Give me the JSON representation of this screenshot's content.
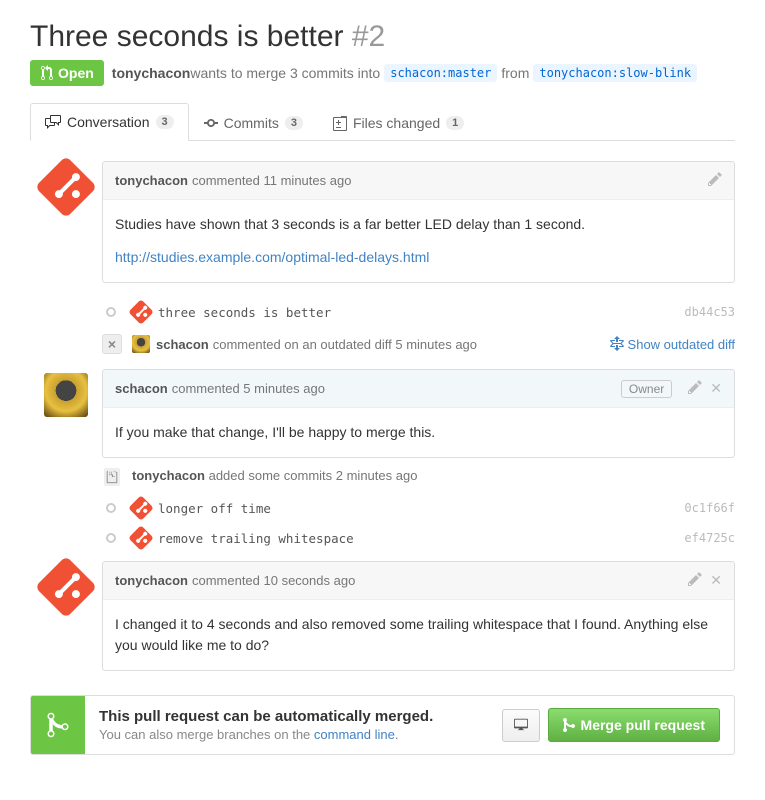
{
  "title": "Three seconds is better",
  "issue_number": "#2",
  "state": "Open",
  "author": "tonychacon",
  "merge_text_prefix": " wants to merge 3 commits into ",
  "base_branch": "schacon:master",
  "merge_text_mid": " from ",
  "head_branch": "tonychacon:slow-blink",
  "tabs": {
    "conversation": {
      "label": "Conversation",
      "count": "3"
    },
    "commits": {
      "label": "Commits",
      "count": "3"
    },
    "files": {
      "label": "Files changed",
      "count": "1"
    }
  },
  "c1": {
    "author": "tonychacon",
    "meta": " commented 11 minutes ago",
    "body": "Studies have shown that 3 seconds is a far better LED delay than 1 second.",
    "link": "http://studies.example.com/optimal-led-delays.html"
  },
  "commit1": {
    "msg": "three seconds is better",
    "sha": "db44c53"
  },
  "outdated": {
    "author": "schacon",
    "meta": " commented on an outdated diff 5 minutes ago",
    "show": "Show outdated diff"
  },
  "c2": {
    "author": "schacon",
    "meta": " commented 5 minutes ago",
    "owner": "Owner",
    "body": "If you make that change, I'll be happy to merge this."
  },
  "push": {
    "author": "tonychacon",
    "meta": " added some commits 2 minutes ago"
  },
  "commit2": {
    "msg": "longer off time",
    "sha": "0c1f66f"
  },
  "commit3": {
    "msg": "remove trailing whitespace",
    "sha": "ef4725c"
  },
  "c3": {
    "author": "tonychacon",
    "meta": " commented 10 seconds ago",
    "body": "I changed it to 4 seconds and also removed some trailing whitespace that I found. Anything else you would like me to do?"
  },
  "merge": {
    "title": "This pull request can be automatically merged.",
    "sub_prefix": "You can also merge branches on the ",
    "sub_link": "command line",
    "sub_suffix": ".",
    "button": "Merge pull request"
  }
}
